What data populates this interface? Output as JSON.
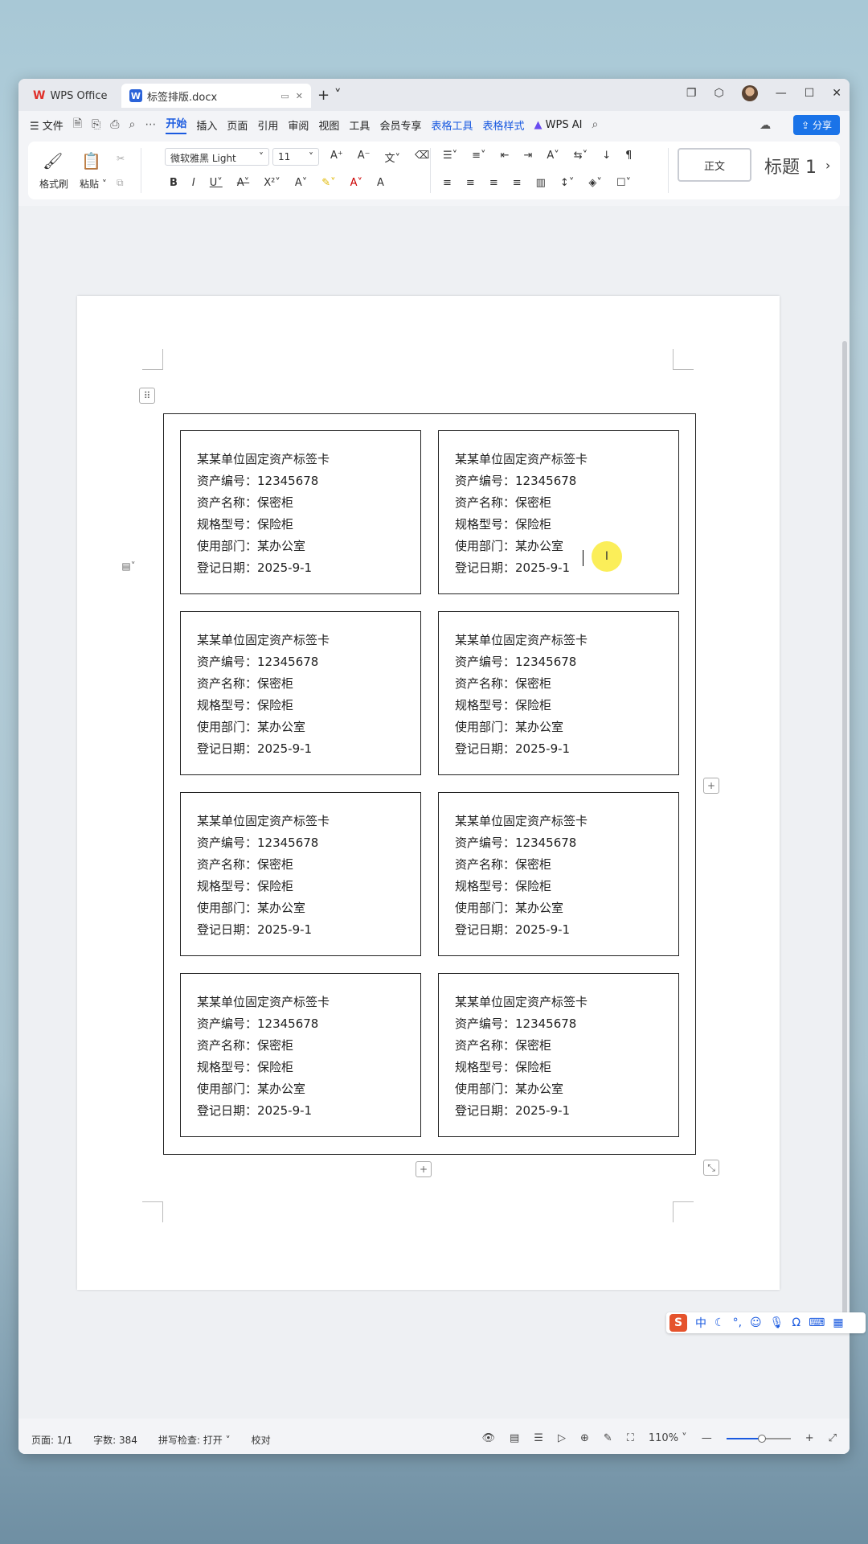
{
  "titlebar": {
    "app_tab": "WPS Office",
    "doc_tab": "标签排版.docx"
  },
  "menubar": {
    "file": "文件",
    "items": [
      "开始",
      "插入",
      "页面",
      "引用",
      "审阅",
      "视图",
      "工具",
      "会员专享"
    ],
    "context_items": [
      "表格工具",
      "表格样式"
    ],
    "ai": "WPS AI",
    "share": "分享"
  },
  "ribbon": {
    "format_painter": "格式刷",
    "paste": "粘贴",
    "font_name": "微软雅黑 Light",
    "font_size": "11",
    "style_normal": "正文",
    "style_heading": "标题 1"
  },
  "labels": [
    {
      "title": "某某单位固定资产标签卡",
      "asset_no": "资产编号：12345678",
      "asset_name": "资产名称：保密柜",
      "model": "规格型号：保险柜",
      "dept": "使用部门：某办公室",
      "date": "登记日期：2025-9-1"
    },
    {
      "title": "某某单位固定资产标签卡",
      "asset_no": "资产编号：12345678",
      "asset_name": "资产名称：保密柜",
      "model": "规格型号：保险柜",
      "dept": "使用部门：某办公室",
      "date": "登记日期：2025-9-1"
    },
    {
      "title": "某某单位固定资产标签卡",
      "asset_no": "资产编号：12345678",
      "asset_name": "资产名称：保密柜",
      "model": "规格型号：保险柜",
      "dept": "使用部门：某办公室",
      "date": "登记日期：2025-9-1"
    },
    {
      "title": "某某单位固定资产标签卡",
      "asset_no": "资产编号：12345678",
      "asset_name": "资产名称：保密柜",
      "model": "规格型号：保险柜",
      "dept": "使用部门：某办公室",
      "date": "登记日期：2025-9-1"
    },
    {
      "title": "某某单位固定资产标签卡",
      "asset_no": "资产编号：12345678",
      "asset_name": "资产名称：保密柜",
      "model": "规格型号：保险柜",
      "dept": "使用部门：某办公室",
      "date": "登记日期：2025-9-1"
    },
    {
      "title": "某某单位固定资产标签卡",
      "asset_no": "资产编号：12345678",
      "asset_name": "资产名称：保密柜",
      "model": "规格型号：保险柜",
      "dept": "使用部门：某办公室",
      "date": "登记日期：2025-9-1"
    },
    {
      "title": "某某单位固定资产标签卡",
      "asset_no": "资产编号：12345678",
      "asset_name": "资产名称：保密柜",
      "model": "规格型号：保险柜",
      "dept": "使用部门：某办公室",
      "date": "登记日期：2025-9-1"
    },
    {
      "title": "某某单位固定资产标签卡",
      "asset_no": "资产编号：12345678",
      "asset_name": "资产名称：保密柜",
      "model": "规格型号：保险柜",
      "dept": "使用部门：某办公室",
      "date": "登记日期：2025-9-1"
    }
  ],
  "ime": {
    "mode": "中"
  },
  "statusbar": {
    "page": "页面: 1/1",
    "word_count": "字数: 384",
    "spell_check": "拼写检查: 打开",
    "proofread": "校对",
    "zoom": "110%",
    "zoom_level": 0.55
  },
  "colors": {
    "accent": "#1a5ae0",
    "wps_red": "#e0302a",
    "share_blue": "#1a73e8"
  }
}
